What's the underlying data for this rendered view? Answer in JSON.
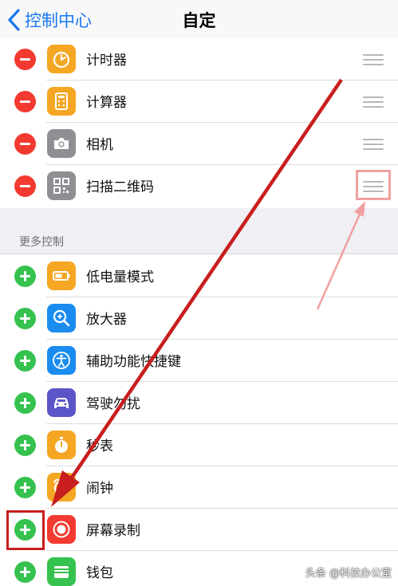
{
  "nav": {
    "back_label": "控制中心",
    "title": "自定"
  },
  "included": [
    {
      "label": "计时器",
      "icon": "timer-icon",
      "icon_bg": "#f5a623"
    },
    {
      "label": "计算器",
      "icon": "calculator-icon",
      "icon_bg": "#f5a623"
    },
    {
      "label": "相机",
      "icon": "camera-icon",
      "icon_bg": "#8e8e93"
    },
    {
      "label": "扫描二维码",
      "icon": "qr-code-icon",
      "icon_bg": "#8e8e93"
    }
  ],
  "more_header": "更多控制",
  "more": [
    {
      "label": "低电量模式",
      "icon": "battery-icon",
      "icon_bg": "#f5a623"
    },
    {
      "label": "放大器",
      "icon": "magnifier-icon",
      "icon_bg": "#1a8cf0"
    },
    {
      "label": "辅助功能快捷键",
      "icon": "accessibility-icon",
      "icon_bg": "#1a8cf0"
    },
    {
      "label": "驾驶勿扰",
      "icon": "car-icon",
      "icon_bg": "#5b55c8"
    },
    {
      "label": "秒表",
      "icon": "stopwatch-icon",
      "icon_bg": "#f5a623"
    },
    {
      "label": "闹钟",
      "icon": "alarm-icon",
      "icon_bg": "#f5a623"
    },
    {
      "label": "屏幕录制",
      "icon": "screen-record-icon",
      "icon_bg": "#f23a30"
    },
    {
      "label": "钱包",
      "icon": "wallet-icon",
      "icon_bg": "#35c24e"
    }
  ],
  "colors": {
    "accent": "#1877f2",
    "remove": "#f23a30",
    "add": "#35c24e",
    "arrow_dark": "#c81e1e",
    "arrow_light": "#f0a0a0"
  },
  "watermark": "头条 @科技办公室"
}
